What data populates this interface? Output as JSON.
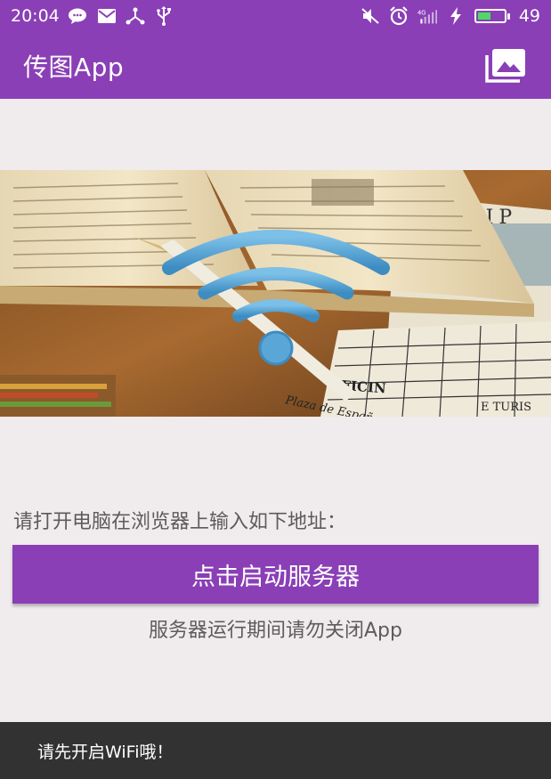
{
  "status_bar": {
    "time": "20:04",
    "battery_level": "49",
    "network_label": "4G",
    "left_icons": [
      "wechat-icon",
      "mail-icon",
      "usb-tether-icon",
      "usb-icon"
    ],
    "right_icons": [
      "mute-icon",
      "alarm-icon",
      "signal-icon",
      "charging-icon",
      "battery-icon"
    ]
  },
  "app_bar": {
    "title": "传图App",
    "action_icon": "gallery-icon"
  },
  "main": {
    "instruction": "请打开电脑在浏览器上输入如下地址：",
    "start_button_label": "点击启动服务器",
    "warning": "服务器运行期间请勿关闭App"
  },
  "toast": {
    "message": "请先开启WiFi哦！"
  },
  "colors": {
    "primary": "#8a3fb6",
    "background": "#f0ebec",
    "text_secondary": "#5f5a5c",
    "toast_bg": "#323232",
    "wifi_blue": "#5aa6d6"
  }
}
